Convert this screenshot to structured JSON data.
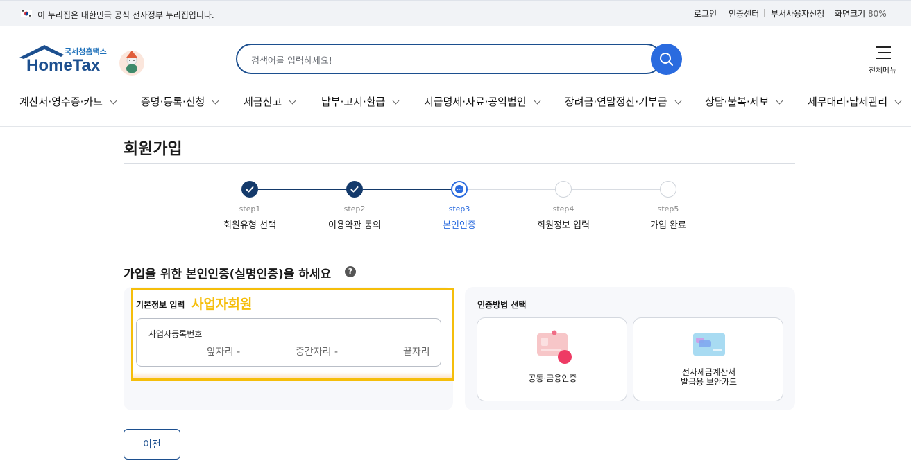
{
  "gov_bar": {
    "notice": "이 누리집은 대한민국 공식 전자정부 누리집입니다.",
    "links": [
      "로그인",
      "인증센터",
      "부서사용자신청"
    ],
    "zoom_label": "화면크기",
    "zoom_value": "80%"
  },
  "header": {
    "logo_small": "국세청홈택스",
    "logo_main": "HomeTax",
    "search_placeholder": "검색어를 입력하세요!",
    "menu_label": "전체메뉴"
  },
  "gnb": [
    "계산서·영수증·카드",
    "증명·등록·신청",
    "세금신고",
    "납부·고지·환급",
    "지급명세·자료·공익법인",
    "장려금·연말정산·기부금",
    "상담·불복·제보",
    "세무대리·납세관리"
  ],
  "page_title": "회원가입",
  "steps": [
    {
      "num": "step1",
      "label": "회원유형 선택",
      "status": "done"
    },
    {
      "num": "step2",
      "label": "이용약관 동의",
      "status": "done"
    },
    {
      "num": "step3",
      "label": "본인인증",
      "status": "current"
    },
    {
      "num": "step4",
      "label": "회원정보 입력",
      "status": "todo"
    },
    {
      "num": "step5",
      "label": "가입 완료",
      "status": "todo"
    }
  ],
  "section_title": "가입을 위한 본인인증(실명인증)을 하세요",
  "basic_info": {
    "label": "기본정보 입력",
    "member_type": "사업자회원",
    "field_label": "사업자등록번호",
    "seg_first": "앞자리",
    "seg_mid": "중간자리",
    "seg_last": "끝자리",
    "dash": "-"
  },
  "auth": {
    "title": "인증방법 선택",
    "option1": "공동·금융인증",
    "option2_line1": "전자세금계산서",
    "option2_line2": "발급용 보안카드"
  },
  "prev_label": "이전",
  "colors": {
    "navy": "#1c4f8f",
    "step_done": "#143a6b",
    "step_current": "#2a6bdf",
    "highlight": "#f5be0b",
    "search_btn": "#2a6bdf"
  }
}
